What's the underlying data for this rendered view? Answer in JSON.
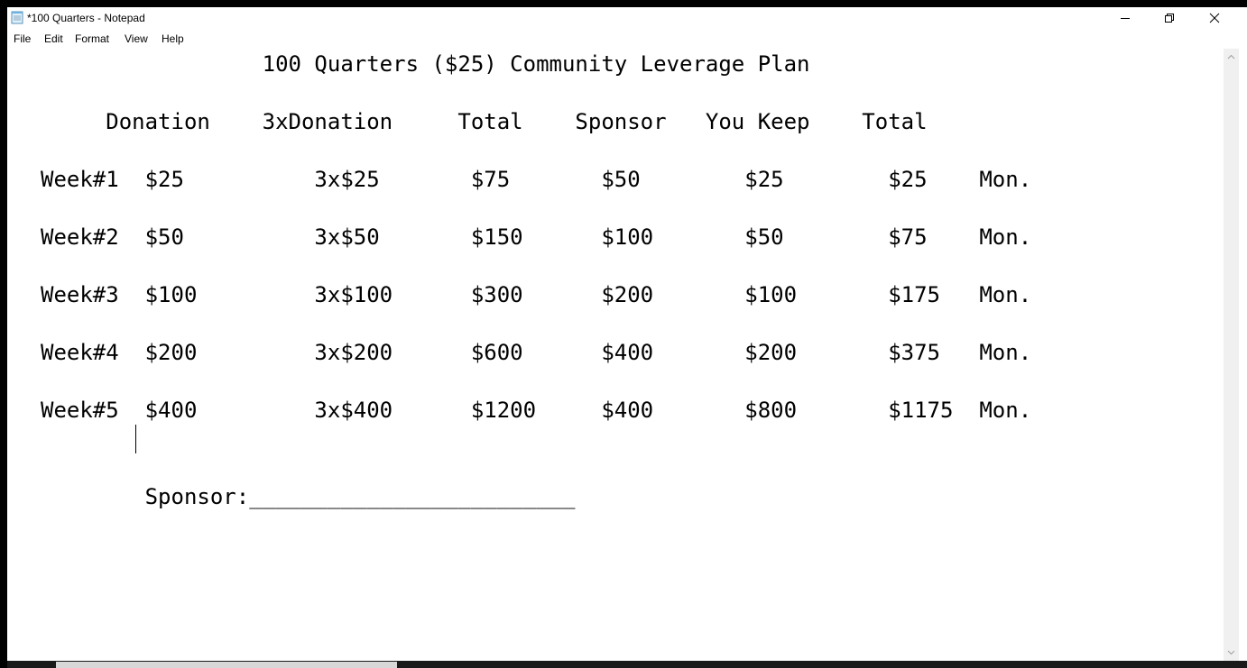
{
  "window": {
    "title": "*100 Quarters - Notepad"
  },
  "menu": {
    "items": [
      "File",
      "Edit",
      "Format",
      "View",
      "Help"
    ]
  },
  "editor": {
    "lines": [
      "                 100 Quarters ($25) Community Leverage Plan",
      "",
      "     Donation    3xDonation     Total    Sponsor   You Keep    Total",
      "",
      "Week#1  $25          3x$25       $75       $50        $25        $25    Mon.",
      "",
      "Week#2  $50          3x$50       $150      $100       $50        $75    Mon.",
      "",
      "Week#3  $100         3x$100      $300      $200       $100       $175   Mon.",
      "",
      "Week#4  $200         3x$200      $600      $400       $200       $375   Mon.",
      "",
      "Week#5  $400         3x$400      $1200     $400       $800       $1175  Mon.",
      "",
      "",
      "        Sponsor:_________________________"
    ]
  },
  "colors": {
    "frame": "#000000",
    "background": "#ffffff",
    "text": "#000000",
    "scrollbar_track": "#f0f0f0"
  },
  "icons": {
    "app": "notepad-icon",
    "minimize": "minimize-icon",
    "maximize": "restore-icon",
    "close": "close-icon",
    "scroll_up": "chevron-up-icon",
    "scroll_down": "chevron-down-icon"
  }
}
